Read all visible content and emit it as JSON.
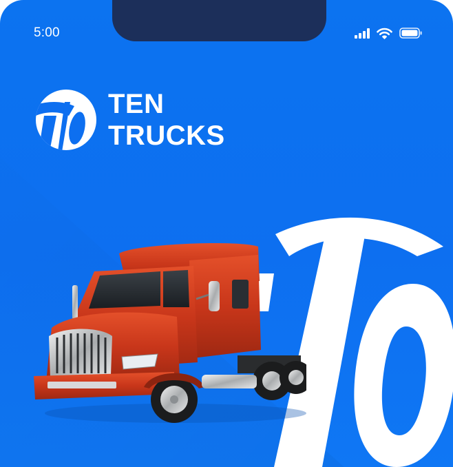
{
  "status_bar": {
    "time": "5:00",
    "icons": [
      "signal-icon",
      "wifi-icon",
      "battery-icon"
    ]
  },
  "brand": {
    "line1": "TEN",
    "line2": "TRUCKS",
    "logo": "ten-trucks-logo-icon"
  },
  "hero": {
    "image": "red-semi-truck-image",
    "background_mark": "large-10-logo-icon"
  },
  "colors": {
    "background": "#0D6FF0",
    "notch": "#1C2F5A",
    "text": "#FFFFFF",
    "truck_red": "#D2381C"
  }
}
